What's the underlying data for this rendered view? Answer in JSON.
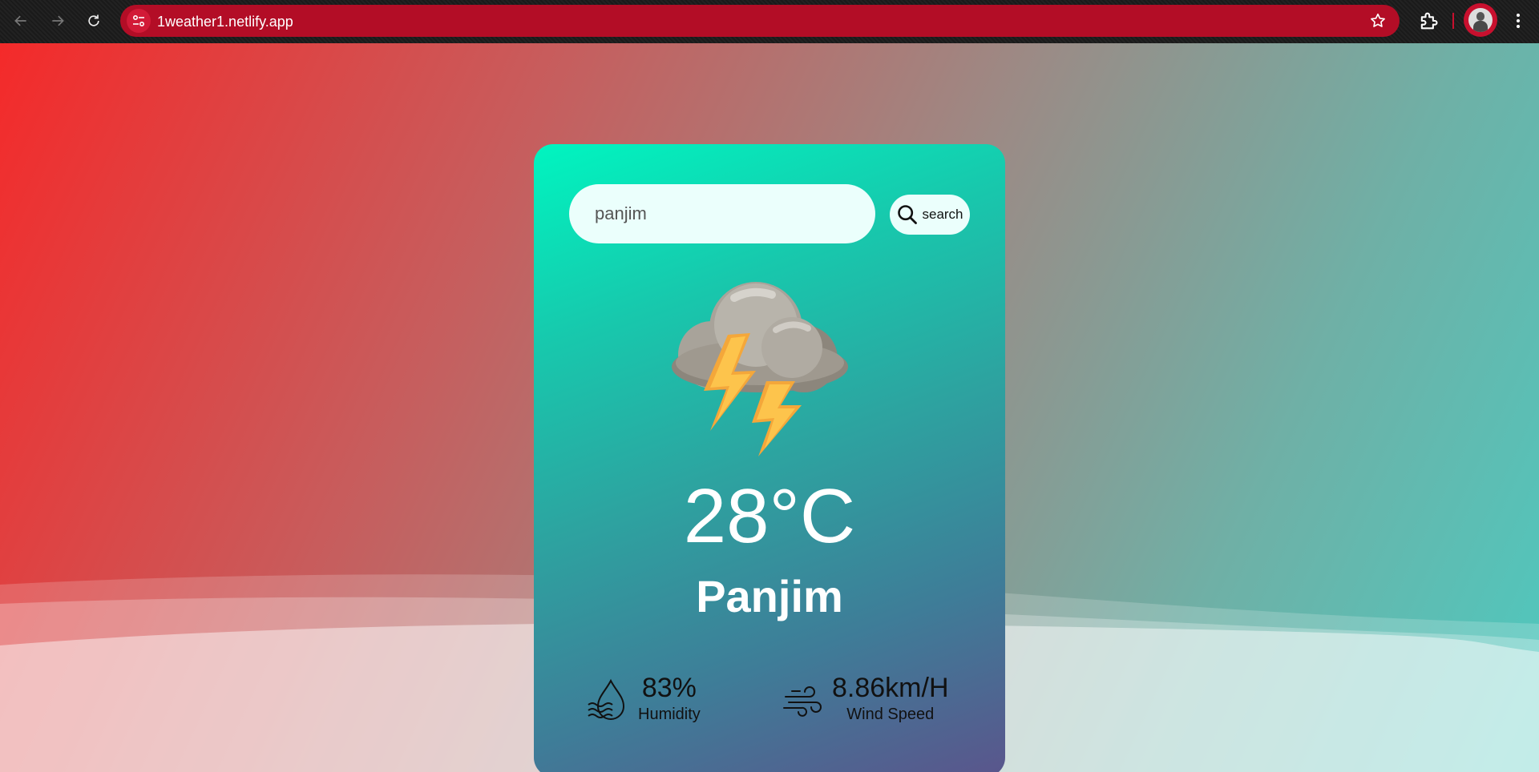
{
  "browser": {
    "url": "1weather1.netlify.app",
    "accent": "#b30d26"
  },
  "search": {
    "value": "panjim",
    "button_label": "search"
  },
  "weather": {
    "icon": "thunderstorm-icon",
    "temperature": "28°C",
    "city": "Panjim",
    "humidity_value": "83%",
    "humidity_label": "Humidity",
    "wind_value": "8.86km/H",
    "wind_label": "Wind Speed"
  }
}
